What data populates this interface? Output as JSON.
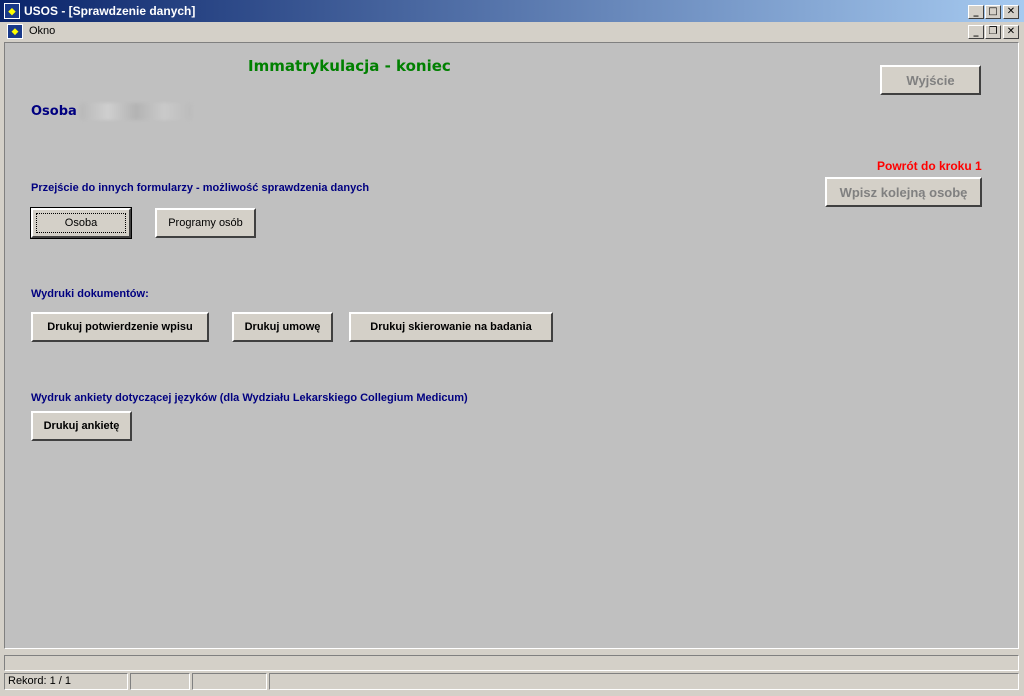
{
  "window": {
    "title": "USOS - [Sprawdzenie danych]",
    "minimize_glyph": "_",
    "maximize_glyph": "□",
    "close_glyph": "✕",
    "restore_glyph": "❐"
  },
  "menubar": {
    "okno": "Okno"
  },
  "form": {
    "heading": "Immatrykulacja - koniec",
    "exit_button": "Wyjście",
    "osoba_label": "Osoba",
    "powrot_label": "Powrót do kroku 1",
    "next_person_button": "Wpisz kolejną osobę",
    "section_forms_label": "Przejście do innych formularzy - możliwość sprawdzenia danych",
    "osoba_button": "Osoba",
    "programy_button": "Programy osób",
    "section_prints_label": "Wydruki dokumentów:",
    "print_confirmation_button": "Drukuj potwierdzenie wpisu",
    "print_contract_button": "Drukuj umowę",
    "print_referral_button": "Drukuj skierowanie na badania",
    "section_survey_label": "Wydruk ankiety dotyczącej języków (dla Wydziału Lekarskiego Collegium Medicum)",
    "print_survey_button": "Drukuj ankietę"
  },
  "status": {
    "record": "Rekord: 1 / 1"
  },
  "colors": {
    "heading": "#008000",
    "label": "#000080",
    "warning": "#ff0000"
  }
}
